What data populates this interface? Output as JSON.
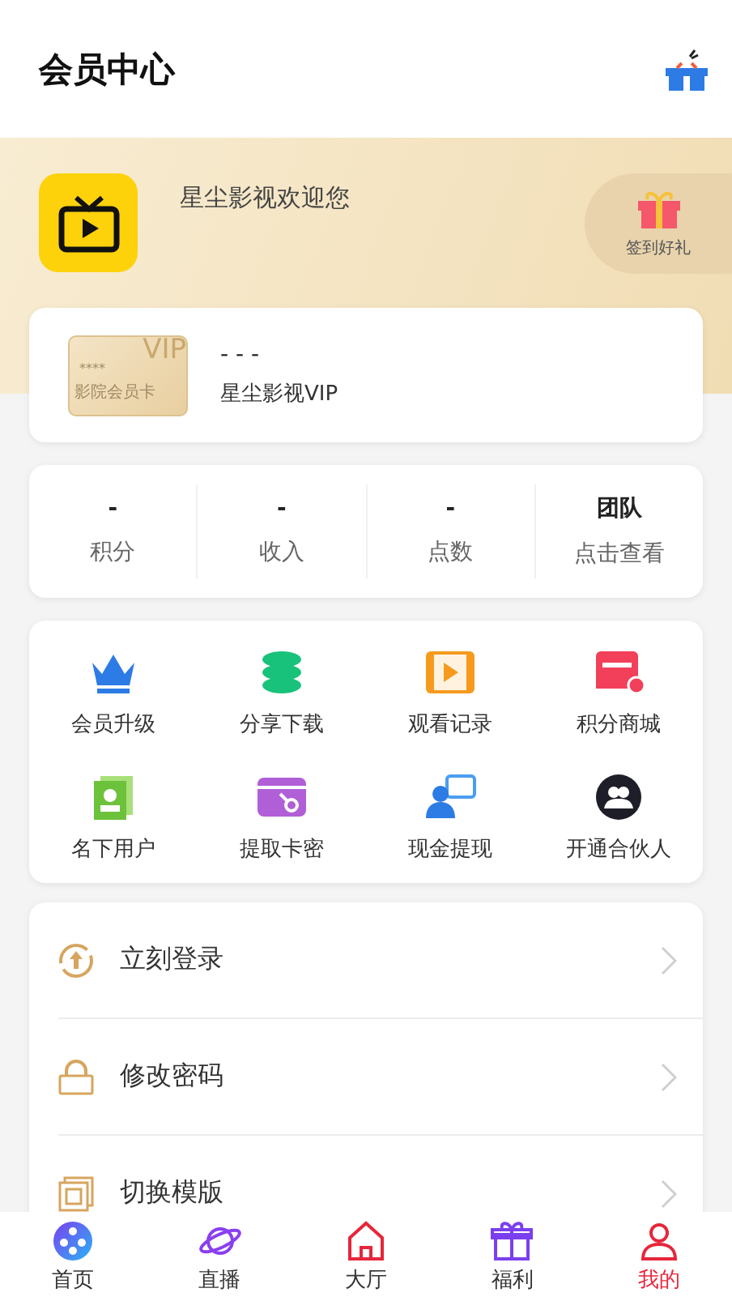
{
  "header": {
    "title": "会员中心"
  },
  "banner": {
    "welcome": "星尘影视欢迎您",
    "checkin": "签到好礼"
  },
  "vip_card": {
    "card_mask": "****",
    "card_watermark": "VIP",
    "card_label": "影院会员卡",
    "number": "- - -",
    "name": "星尘影视VIP"
  },
  "stats": [
    {
      "value": "-",
      "label": "积分"
    },
    {
      "value": "-",
      "label": "收入"
    },
    {
      "value": "-",
      "label": "点数"
    },
    {
      "value": "团队",
      "label": "点击查看"
    }
  ],
  "features": [
    {
      "label": "会员升级"
    },
    {
      "label": "分享下载"
    },
    {
      "label": "观看记录"
    },
    {
      "label": "积分商城"
    },
    {
      "label": "名下用户"
    },
    {
      "label": "提取卡密"
    },
    {
      "label": "现金提现"
    },
    {
      "label": "开通合伙人"
    }
  ],
  "menu": [
    {
      "label": "立刻登录"
    },
    {
      "label": "修改密码"
    },
    {
      "label": "切换模版"
    }
  ],
  "tabs": [
    {
      "label": "首页",
      "selected": false
    },
    {
      "label": "直播",
      "selected": false
    },
    {
      "label": "大厅",
      "selected": false
    },
    {
      "label": "福利",
      "selected": false
    },
    {
      "label": "我的",
      "selected": true
    }
  ]
}
